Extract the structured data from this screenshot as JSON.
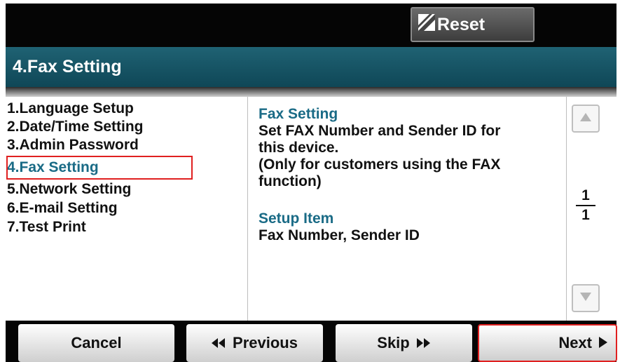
{
  "header": {
    "reset_label": "Reset"
  },
  "title": "4.Fax Setting",
  "menu": {
    "items": [
      "1.Language Setup",
      "2.Date/Time Setting",
      "3.Admin Password",
      "4.Fax Setting",
      "5.Network Setting",
      "6.E-mail Setting",
      "7.Test Print"
    ],
    "selected_index": 3
  },
  "description": {
    "heading": "Fax Setting",
    "text": "Set FAX Number and Sender ID for\nthis device.\n  (Only for customers using the FAX\nfunction)",
    "setup_heading": "Setup Item",
    "setup_text": "Fax Number, Sender ID"
  },
  "pagination": {
    "current": "1",
    "total": "1"
  },
  "footer": {
    "cancel_label": "Cancel",
    "previous_label": "Previous",
    "skip_label": "Skip",
    "next_label": "Next"
  },
  "colors": {
    "accent": "#1a6b86",
    "highlight": "#e02020",
    "titlebar": "#174f60"
  }
}
